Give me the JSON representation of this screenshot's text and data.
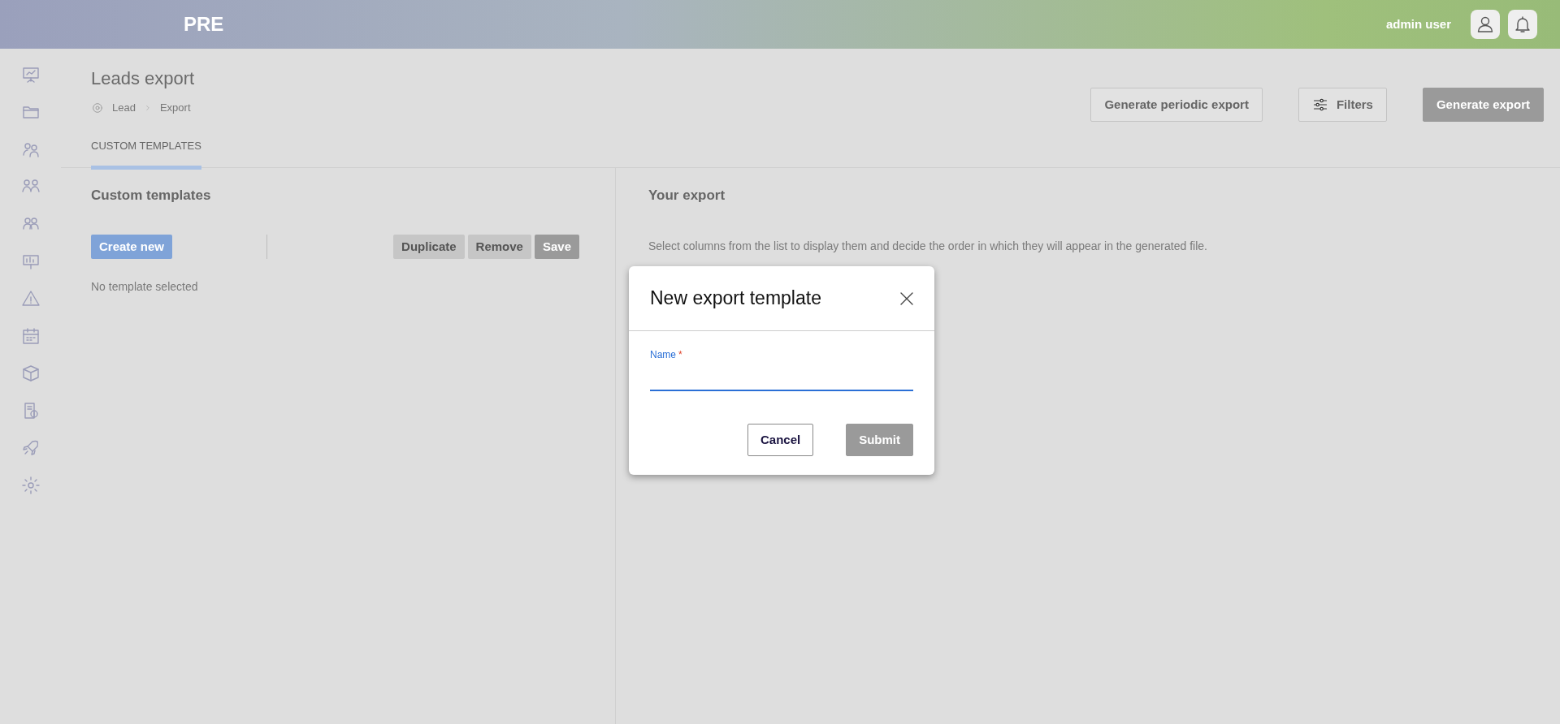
{
  "topbar": {
    "brand": "PRE",
    "user": "admin user"
  },
  "page": {
    "title": "Leads export",
    "breadcrumb": [
      "Lead",
      "Export"
    ],
    "actions": [
      {
        "label": "Generate periodic export",
        "kind": "outline",
        "disabled": false
      },
      {
        "label": "Filters",
        "kind": "filter",
        "disabled": false
      },
      {
        "label": "Generate export",
        "kind": "primary",
        "disabled": true
      }
    ]
  },
  "tabs": [
    {
      "label": "CUSTOM TEMPLATES",
      "selected": true
    }
  ],
  "left_panel": {
    "heading": "Custom templates",
    "buttons": [
      {
        "label": "Create new",
        "kind": "primary",
        "disabled": false
      },
      {
        "label": "Duplicate",
        "kind": "secondary",
        "disabled": false
      },
      {
        "label": "Remove",
        "kind": "secondary",
        "disabled": false
      },
      {
        "label": "Save",
        "kind": "secondary",
        "disabled": true
      }
    ],
    "empty_text": "No template selected"
  },
  "right_panel": {
    "heading": "Your export",
    "hint": "Select columns from the list to display them and decide the order in which they will appear in the generated file."
  },
  "modal": {
    "title": "New export template",
    "field": {
      "label": "Name",
      "required_mark": "*",
      "focused": true
    },
    "buttons": [
      {
        "label": "Cancel",
        "kind": "outline",
        "disabled": false
      },
      {
        "label": "Submit",
        "kind": "primary",
        "disabled": true
      }
    ]
  }
}
